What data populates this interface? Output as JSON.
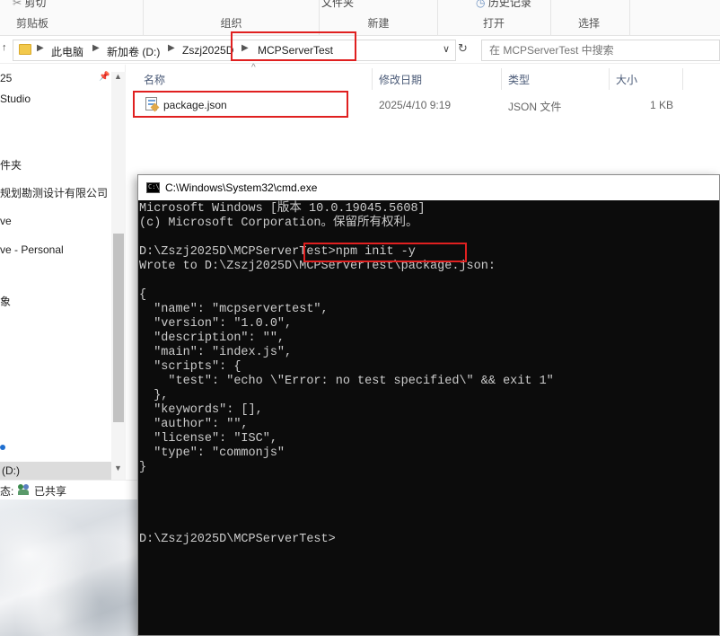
{
  "ribbon": {
    "clipboard_cut": "剪切",
    "clipboard_label": "剪贴板",
    "organize_label": "组织",
    "new_top": "文件夹",
    "new_label": "新建",
    "open_top": "历史记录",
    "open_label": "打开",
    "select_label": "选择"
  },
  "address": {
    "crumbs": [
      "此电脑",
      "新加卷 (D:)",
      "Zszj2025D",
      "MCPServerTest"
    ],
    "search_placeholder": "在 MCPServerTest 中搜索"
  },
  "nav": {
    "items": [
      "25",
      "Studio",
      "件夹",
      "规划勘测设计有限公司",
      "ve",
      "ve - Personal",
      "象",
      "(D:)"
    ]
  },
  "columns": {
    "name": "名称",
    "date": "修改日期",
    "type": "类型",
    "size": "大小"
  },
  "files": [
    {
      "name": "package.json",
      "date": "2025/4/10 9:19",
      "type": "JSON 文件",
      "size": "1 KB"
    }
  ],
  "status": {
    "prefix": "态:",
    "shared": "已共享"
  },
  "cmd": {
    "title": "C:\\Windows\\System32\\cmd.exe",
    "lines": [
      "Microsoft Windows [版本 10.0.19045.5608]",
      "(c) Microsoft Corporation。保留所有权利。",
      "",
      "D:\\Zszj2025D\\MCPServerTest>npm init -y",
      "Wrote to D:\\Zszj2025D\\MCPServerTest\\package.json:",
      "",
      "{",
      "  \"name\": \"mcpservertest\",",
      "  \"version\": \"1.0.0\",",
      "  \"description\": \"\",",
      "  \"main\": \"index.js\",",
      "  \"scripts\": {",
      "    \"test\": \"echo \\\"Error: no test specified\\\" && exit 1\"",
      "  },",
      "  \"keywords\": [],",
      "  \"author\": \"\",",
      "  \"license\": \"ISC\",",
      "  \"type\": \"commonjs\"",
      "}",
      "",
      "",
      "",
      "",
      "D:\\Zszj2025D\\MCPServerTest>"
    ]
  },
  "colors": {
    "highlight": "#e02020",
    "console_bg": "#0c0c0c",
    "console_fg": "#cccccc"
  }
}
